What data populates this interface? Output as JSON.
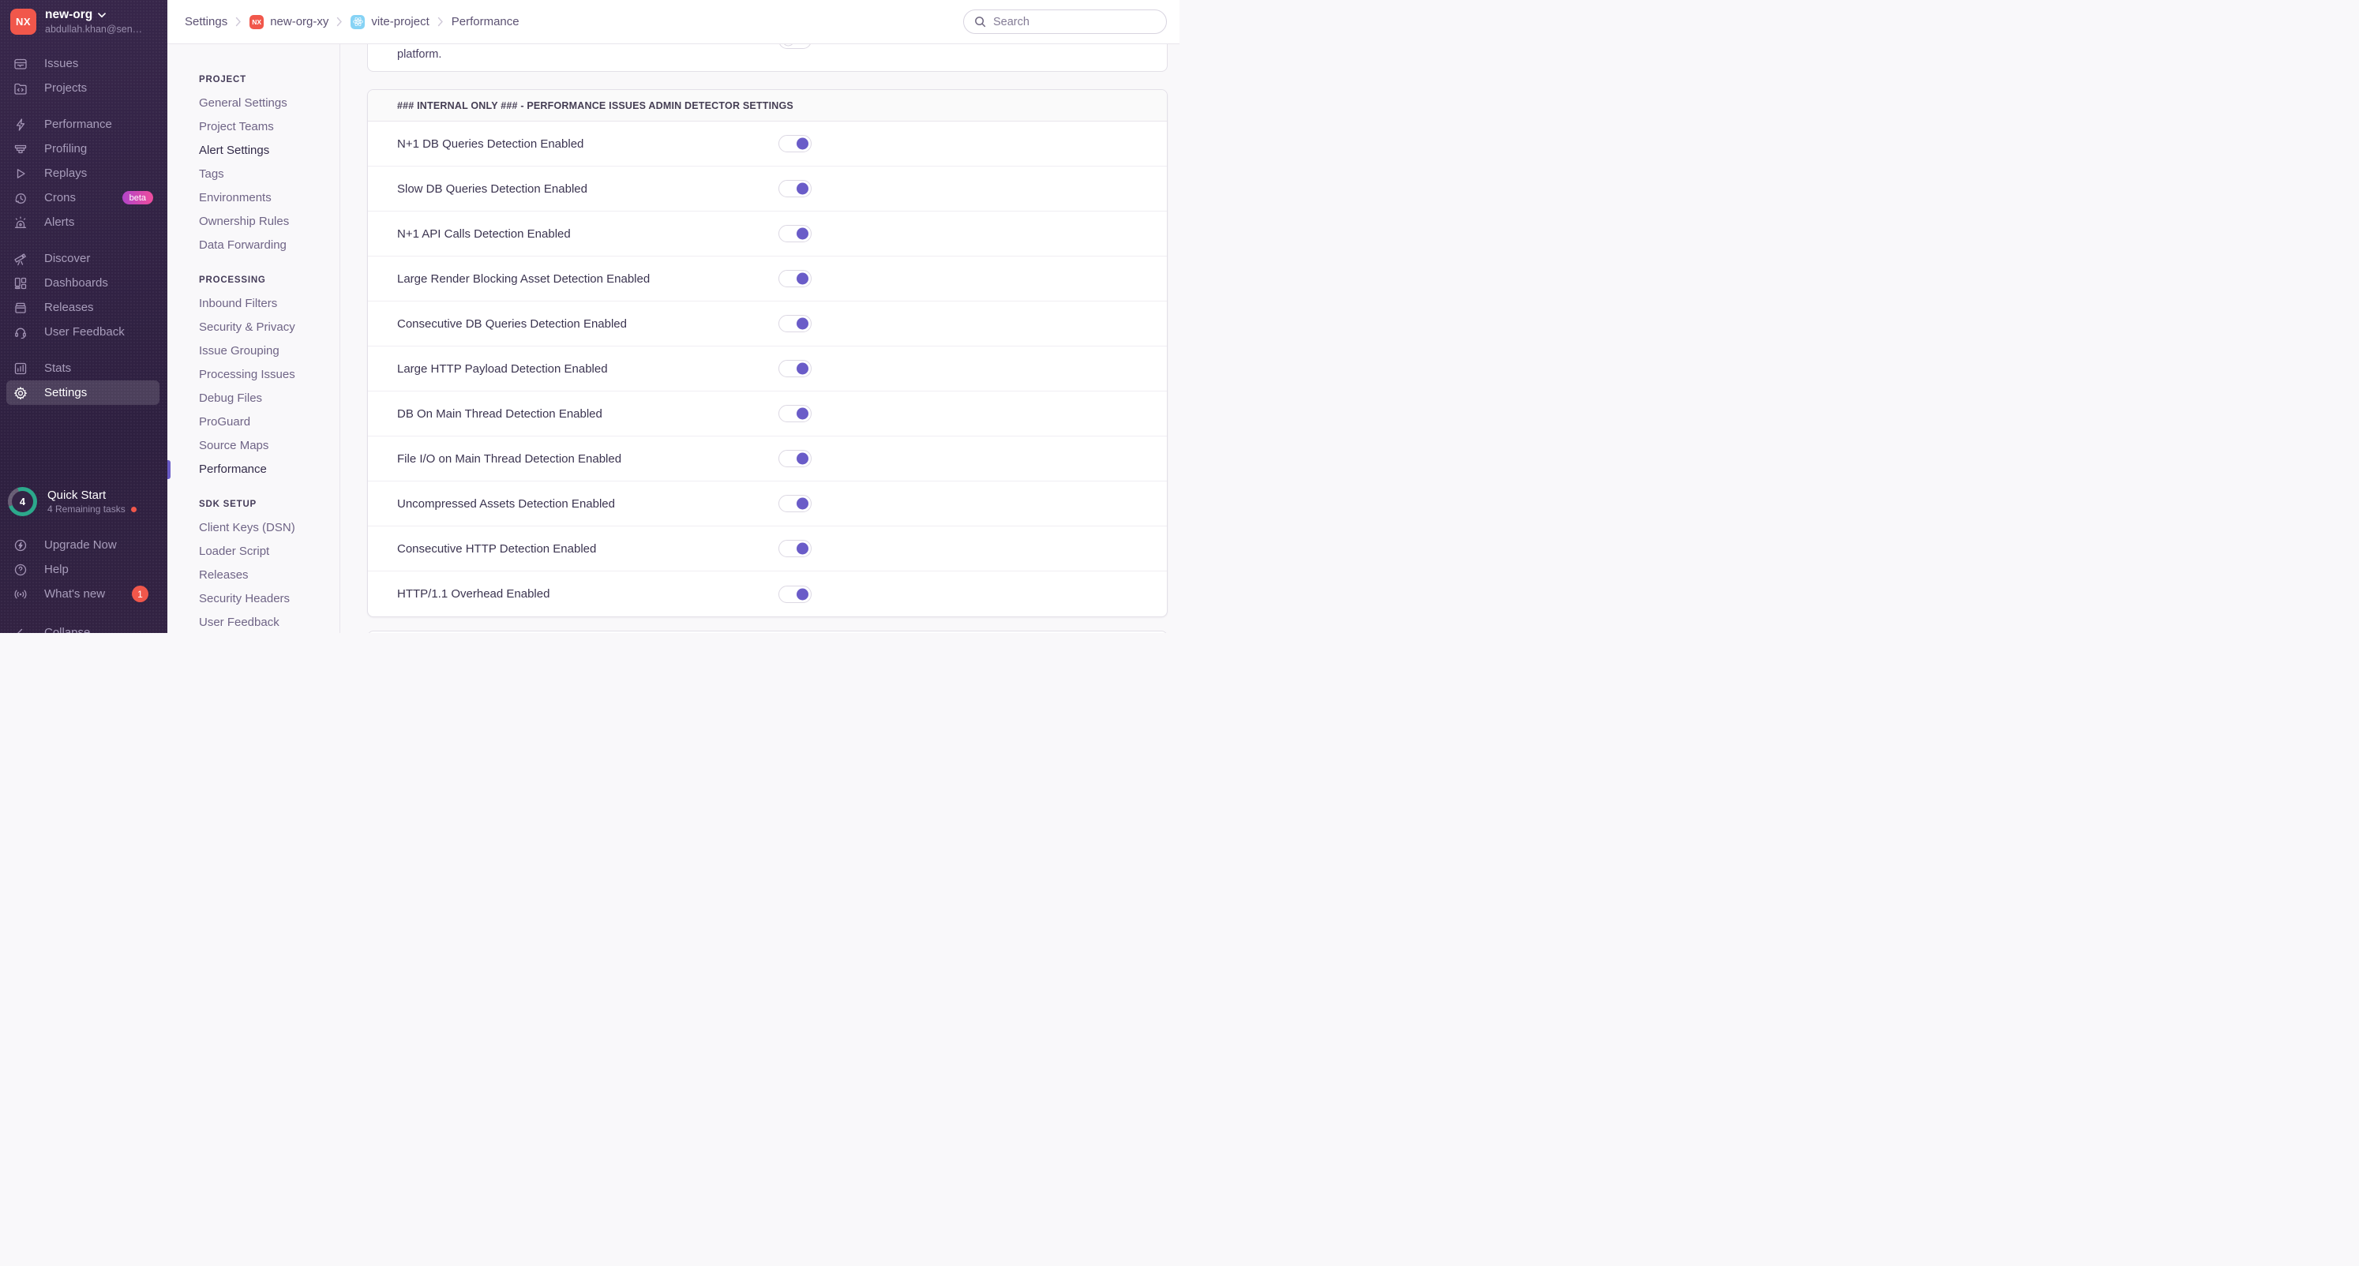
{
  "colors": {
    "accent_purple": "#6a5cc8",
    "sidebar_bg_top": "#38274b",
    "sidebar_bg_bottom": "#2e2040",
    "org_avatar": "#f1574b",
    "beta_gradient_start": "#b245c9",
    "beta_gradient_end": "#ef4d9d",
    "notification_red": "#f1574b",
    "progress_teal": "#2ca98c",
    "react_blue": "#86d3f5"
  },
  "sidebar": {
    "org": {
      "initials": "NX",
      "name": "new-org",
      "email": "abdullah.khan@sen…"
    },
    "nav_groups": [
      [
        {
          "label": "Issues",
          "icon": "issues"
        },
        {
          "label": "Projects",
          "icon": "projects"
        }
      ],
      [
        {
          "label": "Performance",
          "icon": "performance"
        },
        {
          "label": "Profiling",
          "icon": "profiling"
        },
        {
          "label": "Replays",
          "icon": "replays"
        },
        {
          "label": "Crons",
          "icon": "crons",
          "badge": "beta"
        },
        {
          "label": "Alerts",
          "icon": "alerts"
        }
      ],
      [
        {
          "label": "Discover",
          "icon": "discover"
        },
        {
          "label": "Dashboards",
          "icon": "dashboards"
        },
        {
          "label": "Releases",
          "icon": "releases"
        },
        {
          "label": "User Feedback",
          "icon": "user-feedback"
        }
      ],
      [
        {
          "label": "Stats",
          "icon": "stats"
        },
        {
          "label": "Settings",
          "icon": "gear",
          "active": true
        }
      ]
    ],
    "quick_start": {
      "title": "Quick Start",
      "subtitle": "4 Remaining tasks",
      "count": "4"
    },
    "footer_items": [
      {
        "label": "Upgrade Now",
        "icon": "upgrade"
      },
      {
        "label": "Help",
        "icon": "help"
      },
      {
        "label": "What's new",
        "icon": "whats-new",
        "badge": "1"
      }
    ],
    "collapse": {
      "label": "Collapse",
      "icon": "collapse"
    }
  },
  "header": {
    "breadcrumb": [
      {
        "label": "Settings"
      },
      {
        "label": "new-org-xy",
        "tile": "nx",
        "tile_text": "NX"
      },
      {
        "label": "vite-project",
        "tile": "react"
      },
      {
        "label": "Performance"
      }
    ],
    "search_placeholder": "Search"
  },
  "settings_nav": {
    "groups": [
      {
        "heading": "PROJECT",
        "items": [
          {
            "label": "General Settings"
          },
          {
            "label": "Project Teams"
          },
          {
            "label": "Alert Settings",
            "emphasis": true
          },
          {
            "label": "Tags"
          },
          {
            "label": "Environments"
          },
          {
            "label": "Ownership Rules"
          },
          {
            "label": "Data Forwarding"
          }
        ]
      },
      {
        "heading": "PROCESSING",
        "items": [
          {
            "label": "Inbound Filters"
          },
          {
            "label": "Security & Privacy"
          },
          {
            "label": "Issue Grouping"
          },
          {
            "label": "Processing Issues"
          },
          {
            "label": "Debug Files"
          },
          {
            "label": "ProGuard"
          },
          {
            "label": "Source Maps"
          },
          {
            "label": "Performance",
            "active": true
          }
        ]
      },
      {
        "heading": "SDK SETUP",
        "items": [
          {
            "label": "Client Keys (DSN)"
          },
          {
            "label": "Loader Script"
          },
          {
            "label": "Releases"
          },
          {
            "label": "Security Headers"
          },
          {
            "label": "User Feedback"
          }
        ]
      }
    ]
  },
  "main": {
    "clipped_panel": {
      "text": "platform.",
      "toggle_state": "off"
    },
    "panel": {
      "title": "### INTERNAL ONLY ### - PERFORMANCE ISSUES ADMIN DETECTOR SETTINGS",
      "rows": [
        {
          "label": "N+1 DB Queries Detection Enabled",
          "enabled": true
        },
        {
          "label": "Slow DB Queries Detection Enabled",
          "enabled": true
        },
        {
          "label": "N+1 API Calls Detection Enabled",
          "enabled": true
        },
        {
          "label": "Large Render Blocking Asset Detection Enabled",
          "enabled": true
        },
        {
          "label": "Consecutive DB Queries Detection Enabled",
          "enabled": true
        },
        {
          "label": "Large HTTP Payload Detection Enabled",
          "enabled": true
        },
        {
          "label": "DB On Main Thread Detection Enabled",
          "enabled": true
        },
        {
          "label": "File I/O on Main Thread Detection Enabled",
          "enabled": true
        },
        {
          "label": "Uncompressed Assets Detection Enabled",
          "enabled": true
        },
        {
          "label": "Consecutive HTTP Detection Enabled",
          "enabled": true
        },
        {
          "label": "HTTP/1.1 Overhead Enabled",
          "enabled": true
        }
      ]
    }
  }
}
